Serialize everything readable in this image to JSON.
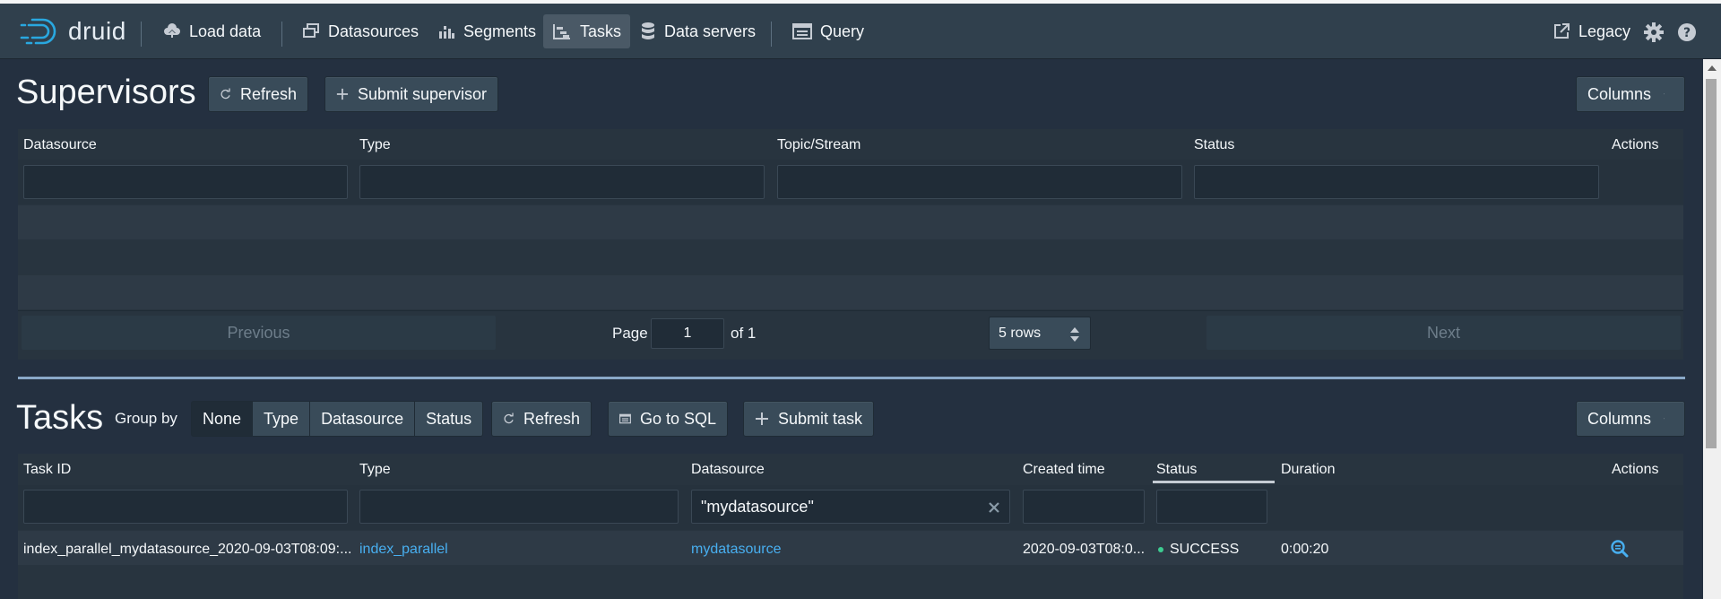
{
  "nav": {
    "logo": "druid",
    "items": [
      {
        "label": "Load data",
        "icon": "cloud-upload-icon"
      },
      {
        "label": "Datasources",
        "icon": "datasources-icon"
      },
      {
        "label": "Segments",
        "icon": "segments-icon"
      },
      {
        "label": "Tasks",
        "icon": "tasks-icon",
        "active": true
      },
      {
        "label": "Data servers",
        "icon": "database-icon"
      },
      {
        "label": "Query",
        "icon": "query-icon"
      }
    ],
    "legacy": "Legacy"
  },
  "supervisors": {
    "title": "Supervisors",
    "refresh": "Refresh",
    "submit": "Submit supervisor",
    "columns_btn": "Columns",
    "columns": [
      "Datasource",
      "Type",
      "Topic/Stream",
      "Status",
      "Actions"
    ],
    "pager": {
      "previous": "Previous",
      "page_label": "Page",
      "page": "1",
      "of": "of 1",
      "rows": "5 rows",
      "next": "Next"
    }
  },
  "tasks": {
    "title": "Tasks",
    "group_by_label": "Group by",
    "group_by": [
      "None",
      "Type",
      "Datasource",
      "Status"
    ],
    "group_by_selected": "None",
    "refresh": "Refresh",
    "go_to_sql": "Go to SQL",
    "submit": "Submit task",
    "columns_btn": "Columns",
    "columns": [
      "Task ID",
      "Type",
      "Datasource",
      "Created time",
      "Status",
      "Duration",
      "Actions"
    ],
    "datasource_filter": "\"mydatasource\"",
    "rows": [
      {
        "task_id": "index_parallel_mydatasource_2020-09-03T08:09:...",
        "type": "index_parallel",
        "datasource": "mydatasource",
        "created": "2020-09-03T08:0...",
        "status": "SUCCESS",
        "duration": "0:00:20"
      }
    ]
  },
  "colors": {
    "accent": "#48aff0",
    "success": "#3dcc91",
    "navbar": "#30404d",
    "background": "#243040"
  }
}
